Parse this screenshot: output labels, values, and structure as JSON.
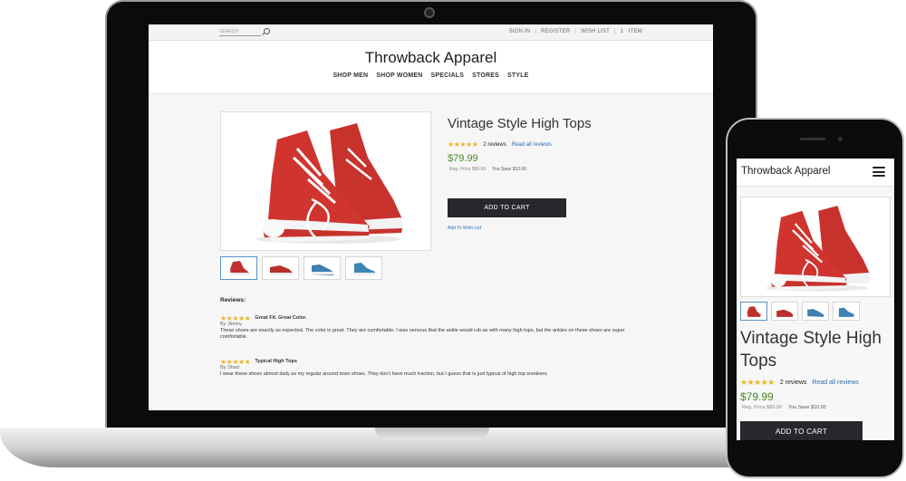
{
  "site": {
    "search_placeholder": "SEARCH",
    "top_links": [
      "SIGN IN",
      "REGISTER",
      "WISH LIST",
      "1   ITEM"
    ],
    "brand": "Throwback Apparel",
    "nav": [
      "SHOP MEN",
      "SHOP WOMEN",
      "SPECIALS",
      "STORES",
      "STYLE"
    ]
  },
  "product": {
    "title": "Vintage Style High Tops",
    "rating_stars": "★★★★★",
    "review_count": "2 reviews",
    "read_reviews": "Read all reviews",
    "price": "$79.99",
    "reg_price": "Reg. Price $89.99",
    "savings": "You Save $10.00",
    "add_to_cart": "ADD TO CART",
    "wish_list": "Add To Wish List",
    "thumb_colors": [
      "#c0302c",
      "#b9302c",
      "#3d7fae",
      "#3d86b4"
    ]
  },
  "reviews": {
    "heading": "Reviews:",
    "items": [
      {
        "stars": "★★★★★",
        "title": "Great Fit. Great Color.",
        "author": "By Jimmy",
        "text": "These shoes are exactly as expected. The color is great. They are comfortable. I was nervous that the ankle would rub as with many high tops, but the ankles on these shoes are super comfortable."
      },
      {
        "stars": "★★★★★",
        "title": "Typical High Tops",
        "author": "By Shad",
        "text": "I wear these shoes almost daily as my regular around town shoes. They don't have much traction, but I guess that is just typical of high top sneakers."
      }
    ]
  },
  "mobile": {
    "brand": "Throwback Apparel",
    "title": "Vintage Style High Tops",
    "review_count": "2 reviews",
    "read_reviews": "Read all reviews",
    "price": "$79.99",
    "reg_price": "Reg. Price $89.99",
    "savings": "You Save $10.00",
    "add_to_cart": "ADD TO CART"
  },
  "colors": {
    "accent_green": "#4a8b23",
    "link_blue": "#2a6db5",
    "button_dark": "#26282b",
    "star_gold": "#f0b323"
  }
}
